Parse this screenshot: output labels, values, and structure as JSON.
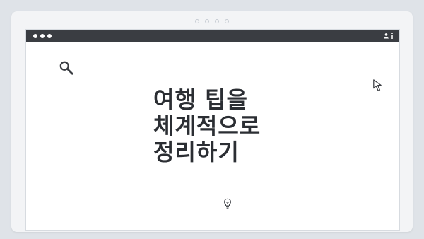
{
  "window": {
    "title_dots": 3,
    "top_indicator_dots": 4
  },
  "content": {
    "headline": "여행 팁을\n체계적으로\n정리하기"
  },
  "icons": {
    "search": "search-icon",
    "cursor": "cursor-arrow-icon",
    "idea": "lightbulb-icon",
    "profile": "user-profile-icon",
    "menu": "kebab-menu-icon"
  },
  "colors": {
    "titlebar": "#3a3d42",
    "page_background": "#dfe3e8",
    "headline": "#2b2e33"
  }
}
